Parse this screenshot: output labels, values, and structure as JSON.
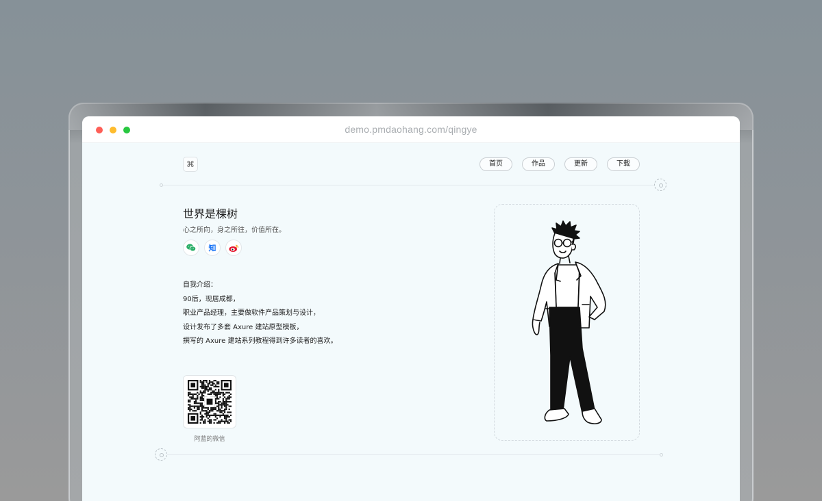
{
  "window": {
    "url": "demo.pmdaohang.com/qingye"
  },
  "header": {
    "logo_glyph": "⌘",
    "nav": [
      {
        "label": "首页"
      },
      {
        "label": "作品"
      },
      {
        "label": "更新"
      },
      {
        "label": "下载"
      }
    ]
  },
  "profile": {
    "title": "世界是棵树",
    "subtitle": "心之所向，身之所往，价值所在。",
    "socials": [
      {
        "icon": "wechat-icon",
        "color": "#2aae67"
      },
      {
        "icon": "zhihu-icon",
        "glyph": "知",
        "color": "#1772f6"
      },
      {
        "icon": "weibo-icon",
        "color": "#e6162d"
      }
    ],
    "intro_lines": [
      "自我介绍：",
      "90后，现居成都，",
      "职业产品经理，主要做软件产品策划与设计，",
      "设计发布了多套 Axure 建站原型模板，",
      "撰写的 Axure 建站系列教程得到许多读者的喜欢。"
    ],
    "qr_caption": "阿蓝的微信"
  },
  "illustration": {
    "subject": "line-art-man-with-glasses"
  }
}
